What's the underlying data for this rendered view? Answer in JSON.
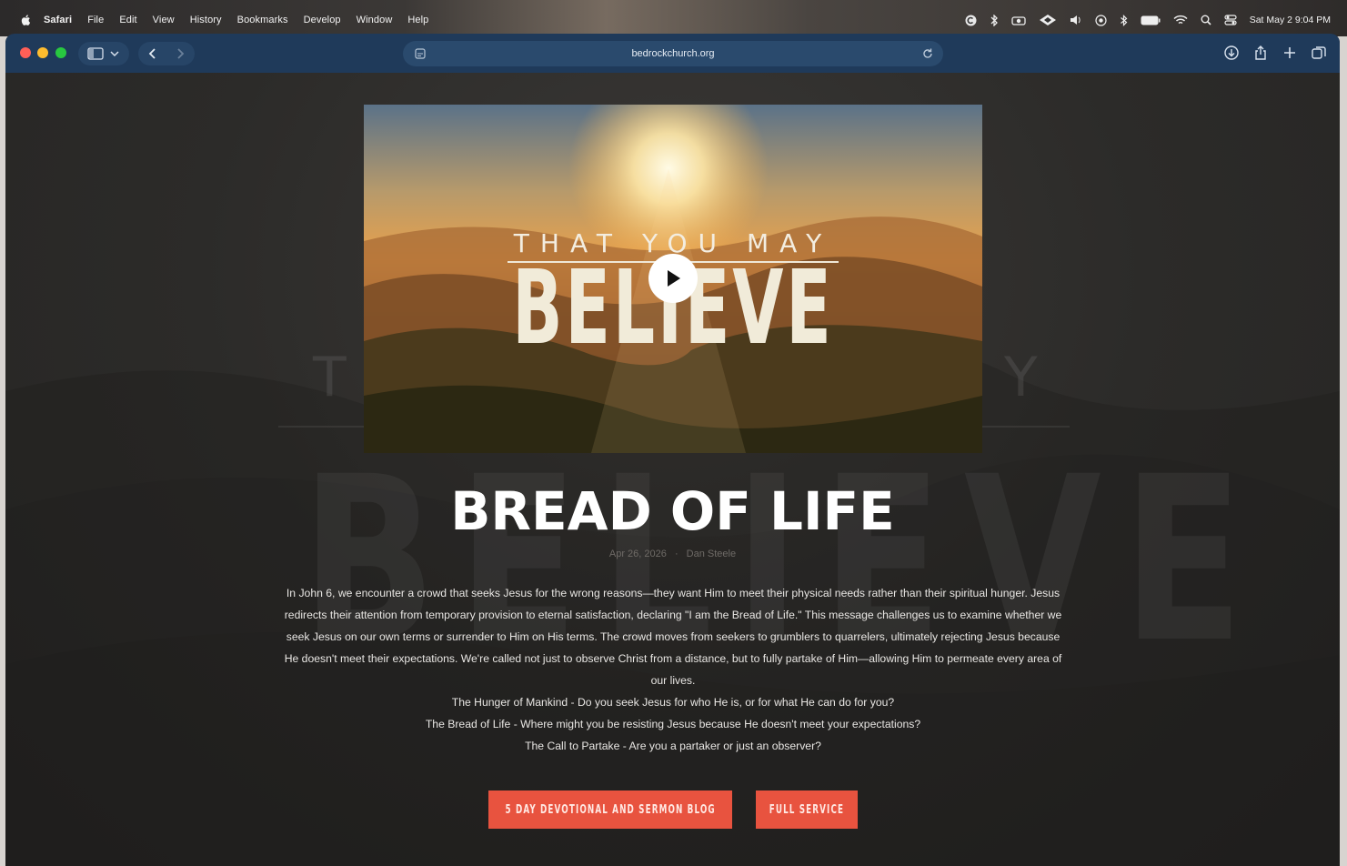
{
  "menubar": {
    "app_name": "Safari",
    "items": [
      "File",
      "Edit",
      "View",
      "History",
      "Bookmarks",
      "Develop",
      "Window",
      "Help"
    ],
    "clock": "Sat May 2  9:04 PM"
  },
  "browser": {
    "url": "bedrockchurch.org"
  },
  "video": {
    "tagline": "THAT YOU MAY",
    "title": "BELIEVE"
  },
  "sermon": {
    "title": "BREAD OF LIFE",
    "date": "Apr 26, 2026",
    "separator": "·",
    "speaker": "Dan Steele",
    "description": "In John 6, we encounter a crowd that seeks Jesus for the wrong reasons—they want Him to meet their physical needs rather than their spiritual hunger. Jesus redirects their attention from temporary provision to eternal satisfaction, declaring \"I am the Bread of Life.\" This message challenges us to examine whether we seek Jesus on our own terms or surrender to Him on His terms. The crowd moves from seekers to grumblers to quarrelers, ultimately rejecting Jesus because He doesn't meet their expectations. We're called not just to observe Christ from a distance, but to fully partake of Him—allowing Him to permeate every area of our lives.",
    "points": [
      "The Hunger of Mankind - Do you seek Jesus for who He is, or for what He can do for you?",
      "The Bread of Life - Where might you be resisting Jesus because He doesn't meet your expectations?",
      "The Call to Partake - Are you a partaker or just an observer?"
    ]
  },
  "buttons": {
    "devotional": "5 DAY DEVOTIONAL AND SERMON BLOG",
    "full_service": "FULL SERVICE"
  },
  "colors": {
    "toolbar": "#1f3a5a",
    "accent_button": "#e8533f",
    "page_bg": "#2b2a29"
  }
}
